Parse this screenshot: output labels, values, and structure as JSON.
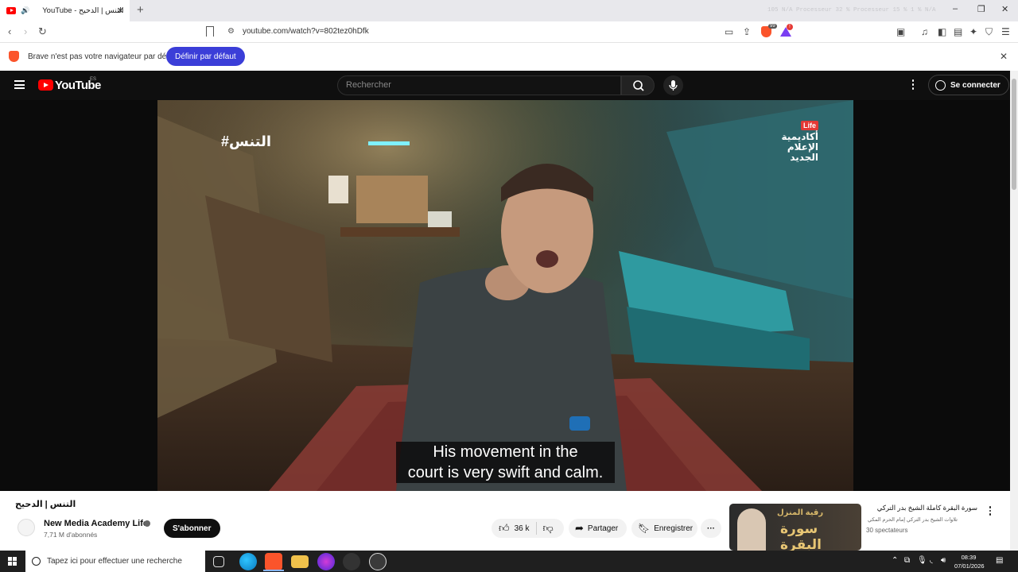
{
  "browser": {
    "tab_title": "YouTube - التنس | الدحيح",
    "new_tab": "+",
    "url": "youtube.com/watch?v=802tez0hDfk",
    "sysmon": "105 N/A   Processeur         32 %   Processeur  15 %   1 % N/A",
    "minimize": "–",
    "restore": "❐",
    "close": "✕"
  },
  "infobar": {
    "message": "Brave n'est pas votre navigateur par défaut",
    "button": "Définir par défaut",
    "close": "✕"
  },
  "youtube": {
    "logo": "YouTube",
    "country": "ES",
    "search_placeholder": "Rechercher",
    "signin": "Se connecter"
  },
  "video": {
    "hashtag": "#التنس",
    "logo_badge": "Life",
    "logo_text": "أكاديمية الإعلام الجديد",
    "subtitle_line1": "His movement in the",
    "subtitle_line2": "court is very swift and calm.",
    "title": "التنس | الدحيح",
    "channel": "New Media Academy Life",
    "subscribers": "7,71 M d'abonnés",
    "subscribe": "S'abonner",
    "likes": "36 k",
    "share": "Partager",
    "save": "Enregistrer",
    "more": "···"
  },
  "recommendation": {
    "thumb_text_small": "رقية المنزل",
    "thumb_text_big": "سورة البقرة",
    "title": "سورة البقرة كاملة الشيخ بدر التركي",
    "channel": "تلاوات الشيخ بدر التركي إمام الحرم المكي",
    "views": "30 spectateurs"
  },
  "taskbar": {
    "search_placeholder": "Tapez ici pour effectuer une recherche",
    "time": "08:39",
    "date": "07/01/2026"
  }
}
